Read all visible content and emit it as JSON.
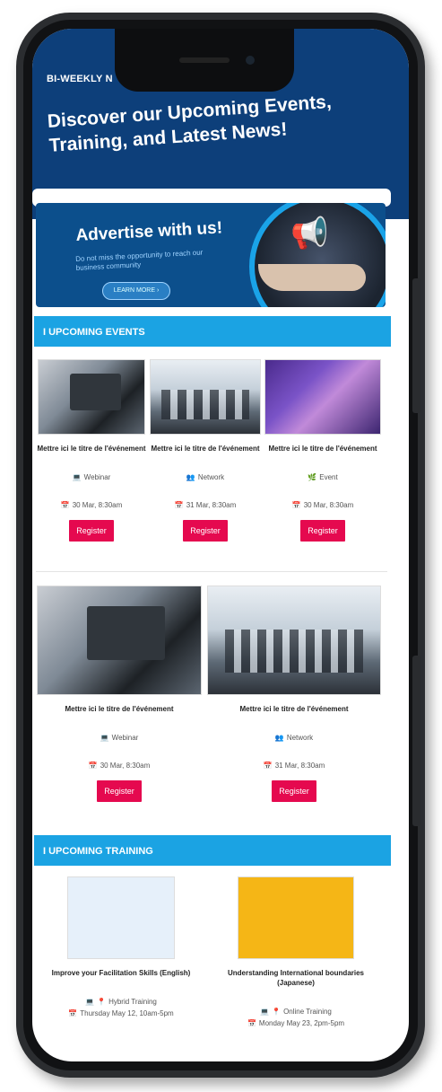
{
  "hero": {
    "kicker": "BI-WEEKLY N",
    "title": "Discover our Upcoming Events, Training, and Latest News!"
  },
  "ad": {
    "title": "Advertise with us!",
    "subtitle": "Do not miss the opportunity to reach our business community",
    "button": "LEARN MORE",
    "icons": [
      "megaphone-icon",
      "hand-icon"
    ]
  },
  "sections": {
    "events": "I UPCOMING EVENTS",
    "training": "I UPCOMING TRAINING"
  },
  "events_row1": [
    {
      "title": "Mettre ici le titre de l'événement",
      "type": "Webinar",
      "icon": "laptop-icon",
      "date": "30 Mar, 8:30am",
      "button": "Register"
    },
    {
      "title": "Mettre ici le titre de l'événement",
      "type": "Network",
      "icon": "people-icon",
      "date": "31 Mar, 8:30am",
      "button": "Register"
    },
    {
      "title": "Mettre ici le titre de l'événement",
      "type": "Event",
      "icon": "plant-icon",
      "date": "30 Mar, 8:30am",
      "button": "Register"
    }
  ],
  "events_row2": [
    {
      "title": "Mettre ici le titre de l'événement",
      "type": "Webinar",
      "icon": "laptop-icon",
      "date": "30 Mar, 8:30am",
      "button": "Register"
    },
    {
      "title": "Mettre ici le titre de l'événement",
      "type": "Network",
      "icon": "people-icon",
      "date": "31 Mar, 8:30am",
      "button": "Register"
    }
  ],
  "training": [
    {
      "title": "Improve your Facilitation Skills (English)",
      "type": "Hybrid Training",
      "date": "Thursday May 12, 10am-5pm"
    },
    {
      "title": "Understanding International boundaries (Japanese)",
      "type": "Online Training",
      "date": "Monday May 23, 2pm-5pm"
    }
  ],
  "colors": {
    "hero_bg": "#0d3f7a",
    "section_bar": "#1ba3e3",
    "register_button": "#e5094f"
  }
}
